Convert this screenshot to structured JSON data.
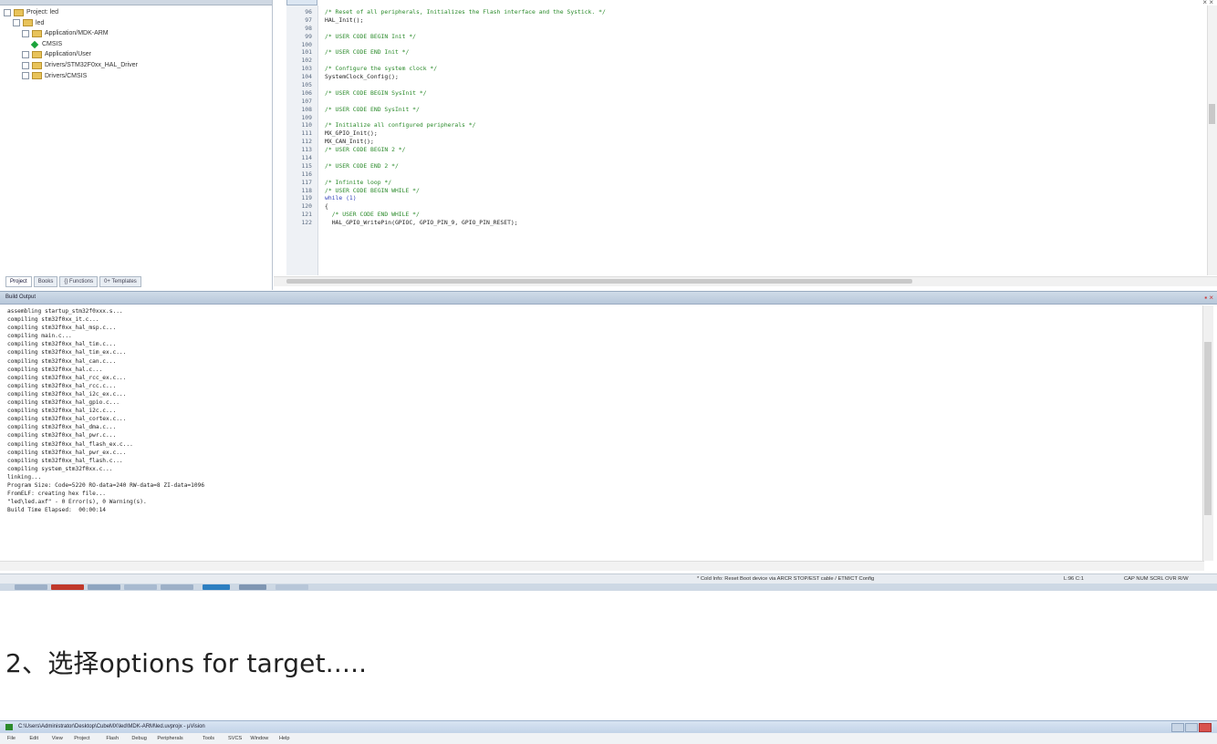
{
  "project": {
    "tree": [
      {
        "label": "Project: led",
        "icon": "project-icon",
        "depth": 0
      },
      {
        "label": "led",
        "icon": "target-folder-icon",
        "depth": 1
      },
      {
        "label": "Application/MDK-ARM",
        "icon": "folder-icon",
        "depth": 2
      },
      {
        "label": "CMSIS",
        "icon": "green-diamond-icon",
        "depth": 2
      },
      {
        "label": "Application/User",
        "icon": "folder-icon",
        "depth": 2
      },
      {
        "label": "Drivers/STM32F0xx_HAL_Driver",
        "icon": "folder-icon",
        "depth": 2
      },
      {
        "label": "Drivers/CMSIS",
        "icon": "folder-icon",
        "depth": 2
      }
    ],
    "tabs": [
      "Project",
      "Books",
      "{} Functions",
      "0+ Templates"
    ]
  },
  "editor": {
    "lines": [
      {
        "n": "96",
        "text": "/* Reset of all peripherals, Initializes the Flash interface and the Systick. */",
        "kind": "c"
      },
      {
        "n": "97",
        "text": "HAL_Init();",
        "kind": "t"
      },
      {
        "n": "98",
        "text": "",
        "kind": "t"
      },
      {
        "n": "99",
        "text": "/* USER CODE BEGIN Init */",
        "kind": "c"
      },
      {
        "n": "100",
        "text": "",
        "kind": "t"
      },
      {
        "n": "101",
        "text": "/* USER CODE END Init */",
        "kind": "c"
      },
      {
        "n": "102",
        "text": "",
        "kind": "t"
      },
      {
        "n": "103",
        "text": "/* Configure the system clock */",
        "kind": "c"
      },
      {
        "n": "104",
        "text": "SystemClock_Config();",
        "kind": "t"
      },
      {
        "n": "105",
        "text": "",
        "kind": "t"
      },
      {
        "n": "106",
        "text": "/* USER CODE BEGIN SysInit */",
        "kind": "c"
      },
      {
        "n": "107",
        "text": "",
        "kind": "t"
      },
      {
        "n": "108",
        "text": "/* USER CODE END SysInit */",
        "kind": "c"
      },
      {
        "n": "109",
        "text": "",
        "kind": "t"
      },
      {
        "n": "110",
        "text": "/* Initialize all configured peripherals */",
        "kind": "c"
      },
      {
        "n": "111",
        "text": "MX_GPIO_Init();",
        "kind": "t"
      },
      {
        "n": "112",
        "text": "MX_CAN_Init();",
        "kind": "t"
      },
      {
        "n": "113",
        "text": "/* USER CODE BEGIN 2 */",
        "kind": "c"
      },
      {
        "n": "114",
        "text": "",
        "kind": "t"
      },
      {
        "n": "115",
        "text": "/* USER CODE END 2 */",
        "kind": "c"
      },
      {
        "n": "116",
        "text": "",
        "kind": "t"
      },
      {
        "n": "117",
        "text": "/* Infinite loop */",
        "kind": "c"
      },
      {
        "n": "118",
        "text": "/* USER CODE BEGIN WHILE */",
        "kind": "c"
      },
      {
        "n": "119",
        "text": "while (1)",
        "kind": "k"
      },
      {
        "n": "120",
        "text": "{",
        "kind": "t"
      },
      {
        "n": "121",
        "text": "  /* USER CODE END WHILE */",
        "kind": "c"
      },
      {
        "n": "122",
        "text": "  HAL_GPIO_WritePin(GPIOC, GPIO_PIN_9, GPIO_PIN_RESET);",
        "kind": "t"
      }
    ]
  },
  "build": {
    "title": "Build Output",
    "lines": [
      "assembling startup_stm32f0xxx.s...",
      "compiling stm32f0xx_it.c...",
      "compiling stm32f0xx_hal_msp.c...",
      "compiling main.c...",
      "compiling stm32f0xx_hal_tim.c...",
      "compiling stm32f0xx_hal_tim_ex.c...",
      "compiling stm32f0xx_hal_can.c...",
      "compiling stm32f0xx_hal.c...",
      "compiling stm32f0xx_hal_rcc_ex.c...",
      "compiling stm32f0xx_hal_rcc.c...",
      "compiling stm32f0xx_hal_i2c_ex.c...",
      "compiling stm32f0xx_hal_gpio.c...",
      "compiling stm32f0xx_hal_i2c.c...",
      "compiling stm32f0xx_hal_cortex.c...",
      "compiling stm32f0xx_hal_dma.c...",
      "compiling stm32f0xx_hal_pwr.c...",
      "compiling stm32f0xx_hal_flash_ex.c...",
      "compiling stm32f0xx_hal_pwr_ex.c...",
      "compiling stm32f0xx_hal_flash.c...",
      "compiling system_stm32f0xx.c...",
      "linking...",
      "Program Size: Code=5220 RO-data=240 RW-data=8 ZI-data=1096",
      "FromELF: creating hex file...",
      "\"led\\led.axf\" - 0 Error(s), 0 Warning(s).",
      "Build Time Elapsed:  00:00:14"
    ]
  },
  "status": {
    "debugger": "* Cold Info: Reset Boot device via ARCR STOP/EST cable / ETM/CT Config",
    "position": "L:96 C:1",
    "flags": "CAP NUM SCRL OVR R/W"
  },
  "heading": "2、选择options for target.....",
  "window2": {
    "title": "C:\\Users\\Administrator\\Desktop\\CubeMX\\led\\MDK-ARM\\led.uvprojx - µVision",
    "menu": [
      "File",
      "Edit",
      "View",
      "Project",
      "Flash",
      "Debug",
      "Peripherals",
      "Tools",
      "SVCS",
      "Window",
      "Help"
    ]
  },
  "colors": {
    "comment": "#2a8a2a",
    "keyword": "#3344bb",
    "accent_titlebar": "#c2d3e8"
  }
}
